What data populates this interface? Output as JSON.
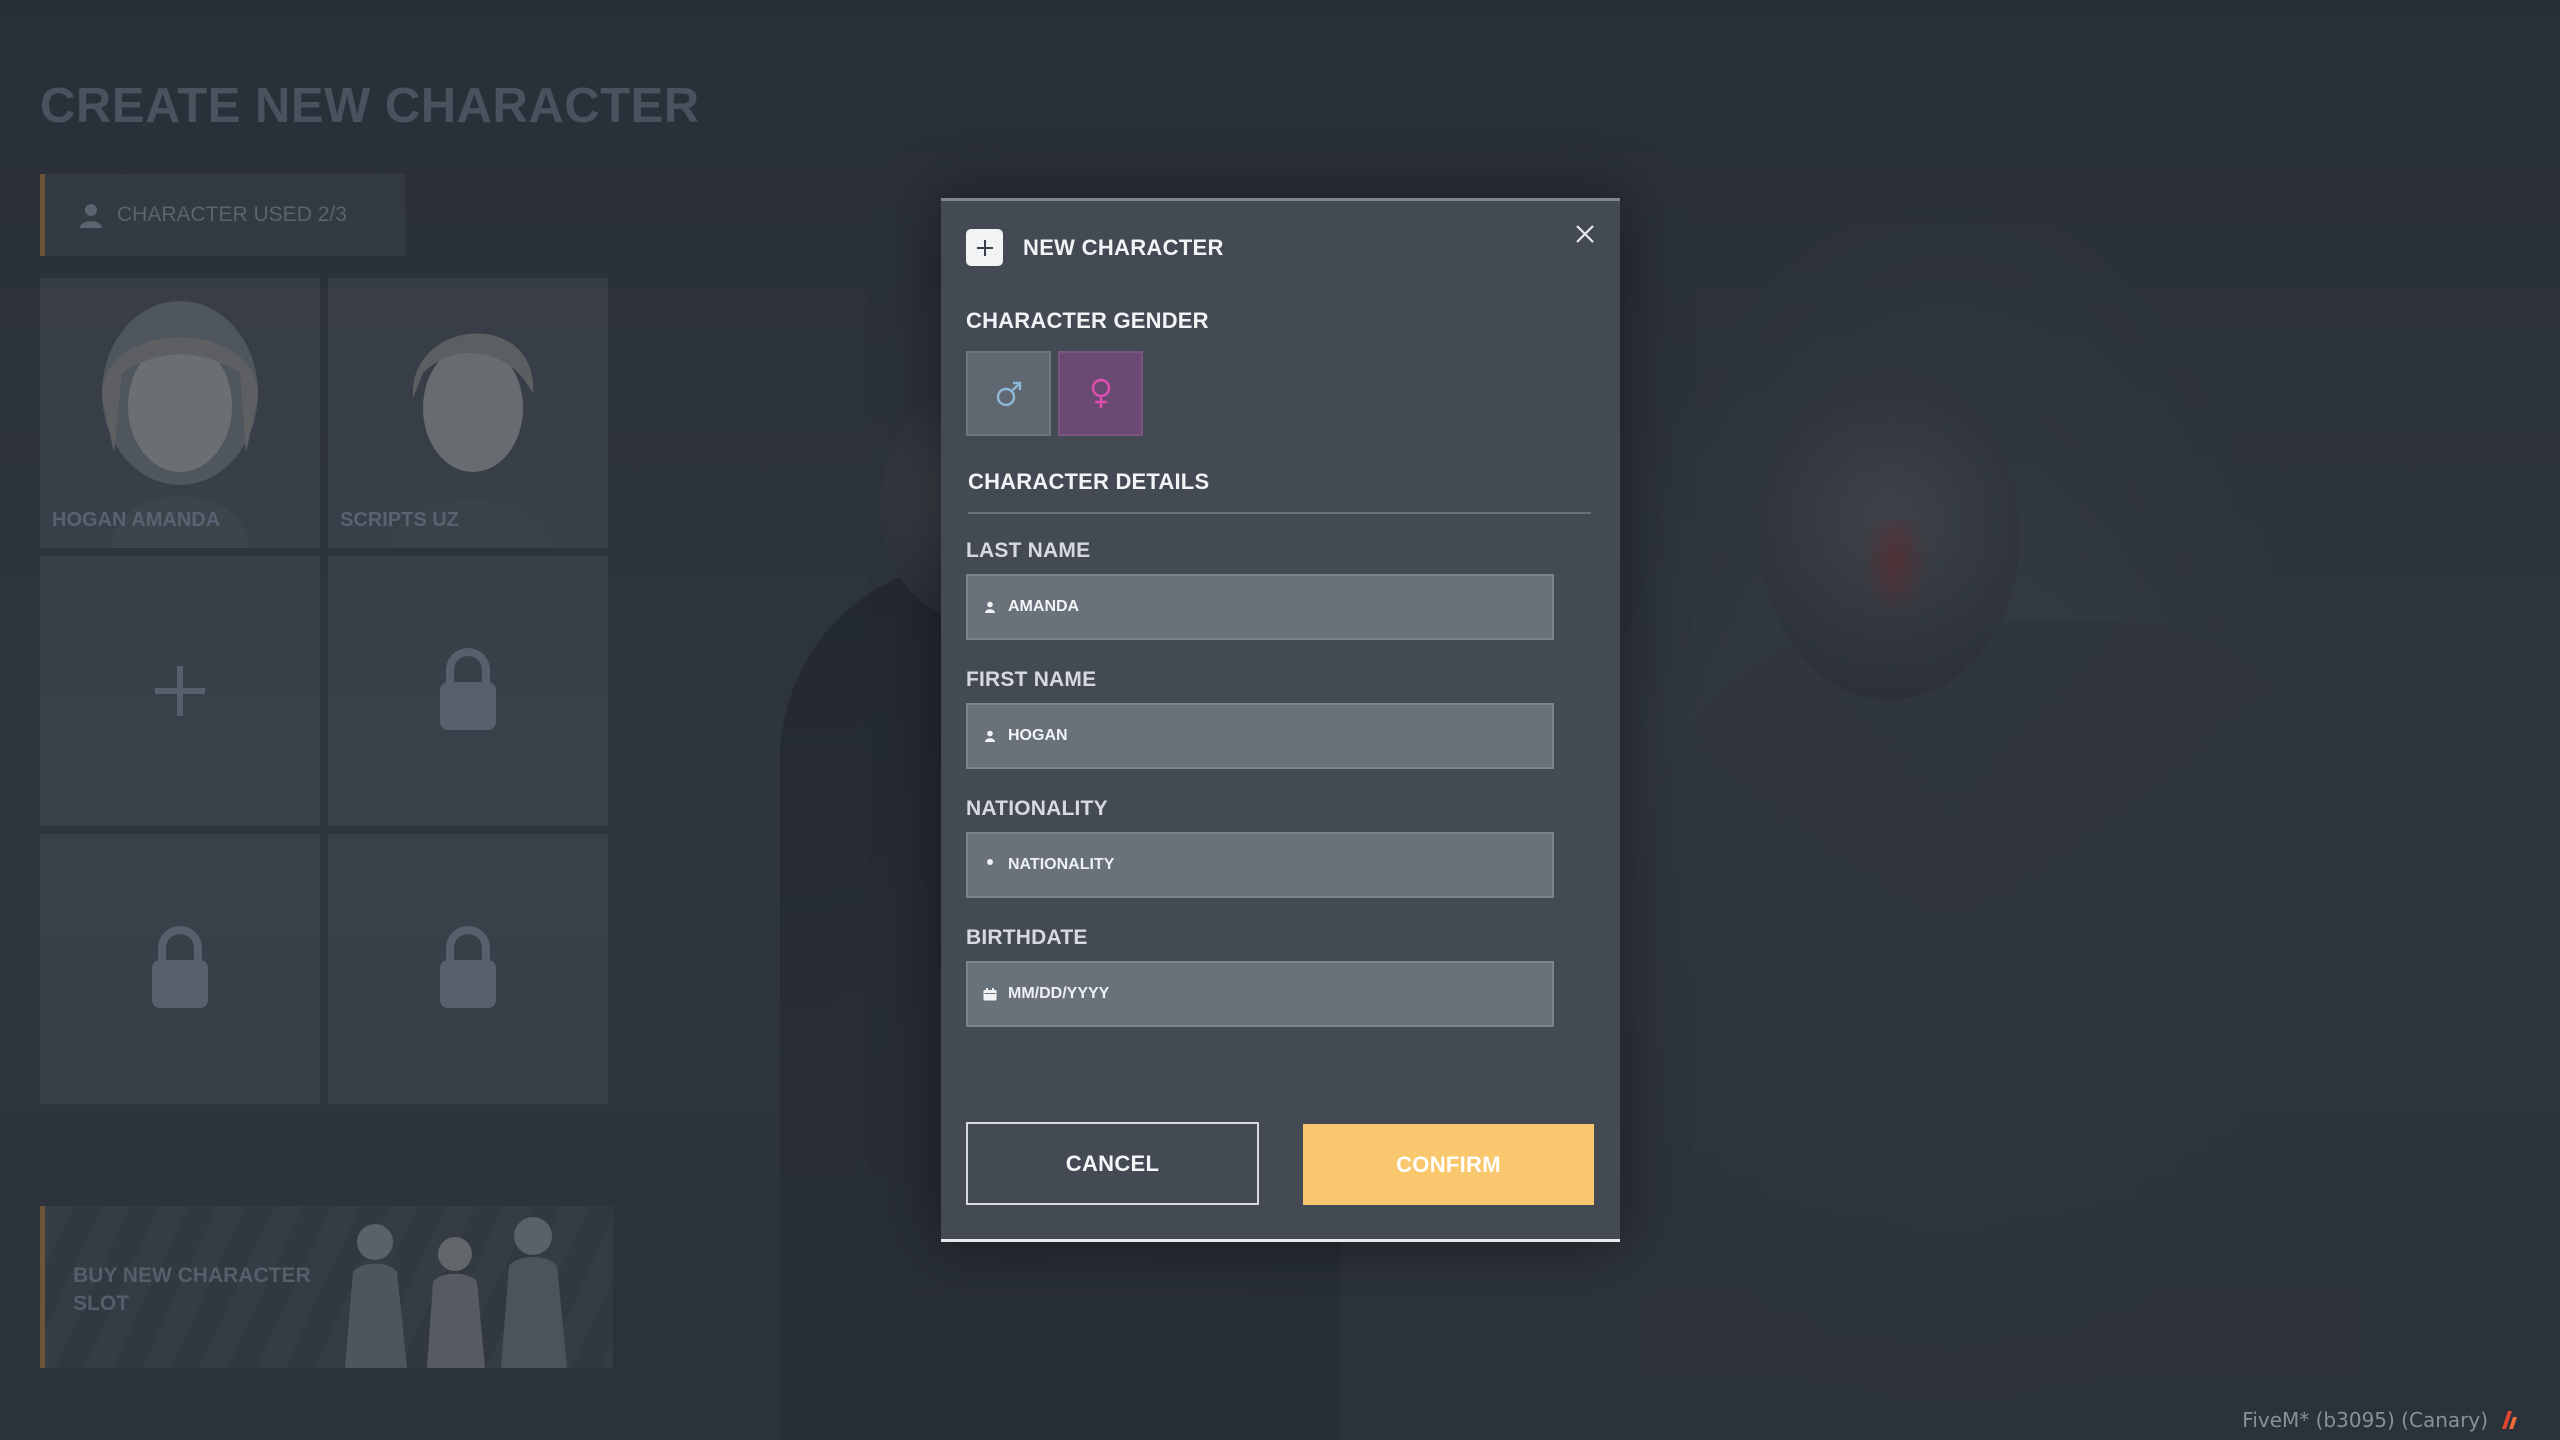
{
  "page": {
    "title": "CREATE NEW CHARACTER",
    "slot_counter": "CHARACTER USED 2/3",
    "characters": [
      {
        "name": "HOGAN AMANDA",
        "state": "filled"
      },
      {
        "name": "SCRIPTS UZ",
        "state": "filled"
      },
      {
        "name": "",
        "state": "empty"
      },
      {
        "name": "",
        "state": "locked"
      },
      {
        "name": "",
        "state": "locked"
      },
      {
        "name": "",
        "state": "locked"
      }
    ],
    "buy_slot": "BUY NEW CHARACTER SLOT",
    "watermark": "FiveM* (b3095) (Canary)"
  },
  "modal": {
    "title": "NEW CHARACTER",
    "gender_label": "CHARACTER GENDER",
    "genders": [
      {
        "symbol": "♂",
        "name": "male",
        "color": "#8fb7d6"
      },
      {
        "symbol": "♀",
        "name": "female",
        "color": "#e04fb0"
      }
    ],
    "details_label": "CHARACTER DETAILS",
    "fields": {
      "last_name": {
        "label": "LAST NAME",
        "value": "AMANDA",
        "placeholder": ""
      },
      "first_name": {
        "label": "FIRST NAME",
        "value": "HOGAN",
        "placeholder": ""
      },
      "nationality": {
        "label": "NATIONALITY",
        "value": "",
        "placeholder": "NATIONALITY"
      },
      "birthdate": {
        "label": "BIRTHDATE",
        "value": "",
        "placeholder": "MM/DD/YYYY"
      }
    },
    "cancel_label": "CANCEL",
    "confirm_label": "CONFIRM"
  },
  "colors": {
    "accent": "#f9c76e",
    "modal_bg": "#434a54",
    "female": "#6a4a72"
  }
}
